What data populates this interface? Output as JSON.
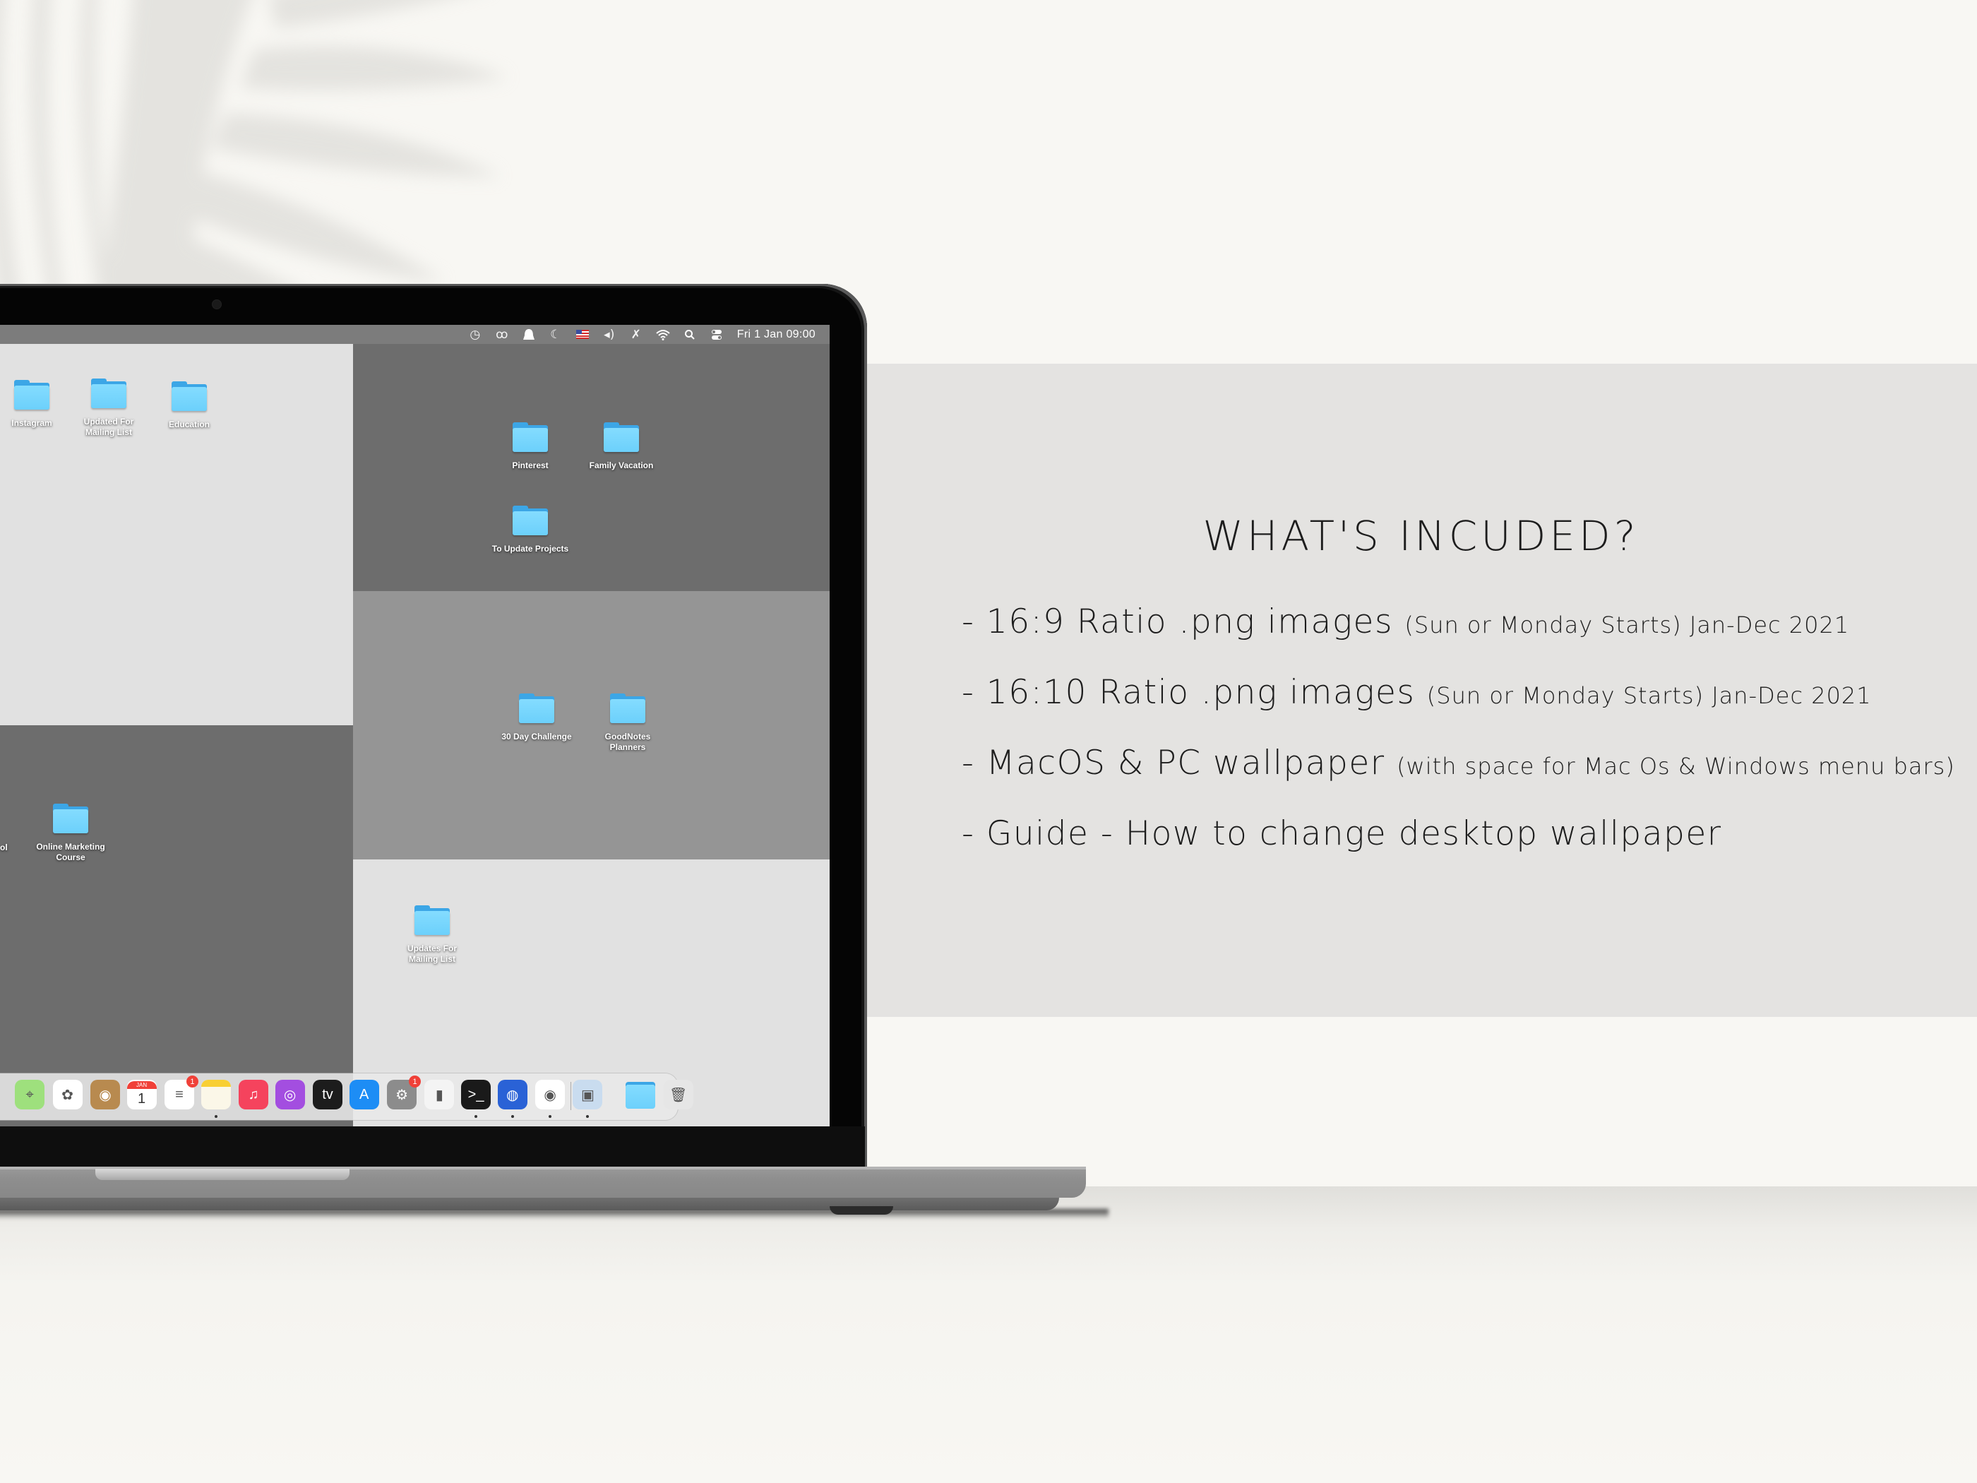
{
  "menubar": {
    "icons": [
      "timer-icon",
      "glasses-icon",
      "notification-icon",
      "moon-icon",
      "us-flag-icon",
      "volume-icon",
      "bluetooth-off-icon",
      "wifi-icon",
      "search-icon",
      "control-center-icon"
    ],
    "icon_glyphs": [
      "◷",
      "ꝏ",
      "▲",
      "☾",
      "▤",
      "◂)",
      "✗",
      "⌔",
      "⚲",
      "▭"
    ],
    "clock": "Fri 1 Jan  09:00"
  },
  "desktop": {
    "folders": [
      {
        "label": "Instagram"
      },
      {
        "label": "Updated For Mailing List"
      },
      {
        "label": "Education"
      },
      {
        "label": "Pinterest"
      },
      {
        "label": "Family Vacation"
      },
      {
        "label": "To Update Projects"
      },
      {
        "label": "30 Day Challenge"
      },
      {
        "label": "GoodNotes Planners"
      },
      {
        "label": "Online Marketing Course"
      },
      {
        "label": "Updates For Mailing List"
      }
    ],
    "partial_label": "ol"
  },
  "dock": {
    "apps": [
      {
        "name": "Maps",
        "glyph": "⌖",
        "color": "#9ee07d"
      },
      {
        "name": "Photos",
        "glyph": "✿",
        "color": "#ffffff"
      },
      {
        "name": "Contacts",
        "glyph": "◉",
        "color": "#b88a4f"
      },
      {
        "name": "Calendar",
        "glyph": "1",
        "month": "JAN",
        "color": "#ffffff"
      },
      {
        "name": "Reminders",
        "glyph": "≡",
        "color": "#ffffff",
        "badge": "1"
      },
      {
        "name": "Notes",
        "glyph": "",
        "color": "#fbf7e8"
      },
      {
        "name": "Music",
        "glyph": "♫",
        "color": "#f5435d"
      },
      {
        "name": "Podcasts",
        "glyph": "◎",
        "color": "#a34ee0"
      },
      {
        "name": "TV",
        "glyph": "tv",
        "color": "#1c1c1c"
      },
      {
        "name": "App Store",
        "glyph": "A",
        "color": "#1d8df5"
      },
      {
        "name": "System Preferences",
        "glyph": "⚙",
        "color": "#8c8c8c",
        "badge": "1"
      },
      {
        "name": "Numbers",
        "glyph": "▮",
        "color": "#f4f4f4"
      },
      {
        "name": "Terminal",
        "glyph": ">_",
        "color": "#1a1a1a"
      },
      {
        "name": "Firefox",
        "glyph": "◍",
        "color": "#2a62d6"
      },
      {
        "name": "Chrome",
        "glyph": "◉",
        "color": "#ffffff"
      },
      {
        "name": "Preview",
        "glyph": "▣",
        "color": "#c9dcef"
      },
      {
        "name": "Downloads Folder",
        "glyph": "",
        "color": "#6cd0fb"
      },
      {
        "name": "Trash",
        "glyph": "🗑",
        "color": "#e6e6e6"
      }
    ]
  },
  "panel": {
    "title": "WHAT'S INCUDED?",
    "features": [
      {
        "main": "- 16:9 Ratio .png images ",
        "note": "(Sun or Monday Starts) Jan-Dec 2021"
      },
      {
        "main": "- 16:10 Ratio .png images ",
        "note": "(Sun or Monday Starts) Jan-Dec 2021"
      },
      {
        "main": "- MacOS & PC wallpaper ",
        "note": "(with space for Mac Os & Windows menu bars)"
      },
      {
        "main": "- Guide - How to change desktop wallpaper",
        "note": ""
      }
    ]
  },
  "colors": {
    "background": "#f8f7f3",
    "panel": "#e4e3e1",
    "tile_light": "#e1e1e1",
    "tile_mid": "#959595",
    "tile_dark": "#6d6d6d",
    "folder_blue": "#6cd0fb"
  }
}
